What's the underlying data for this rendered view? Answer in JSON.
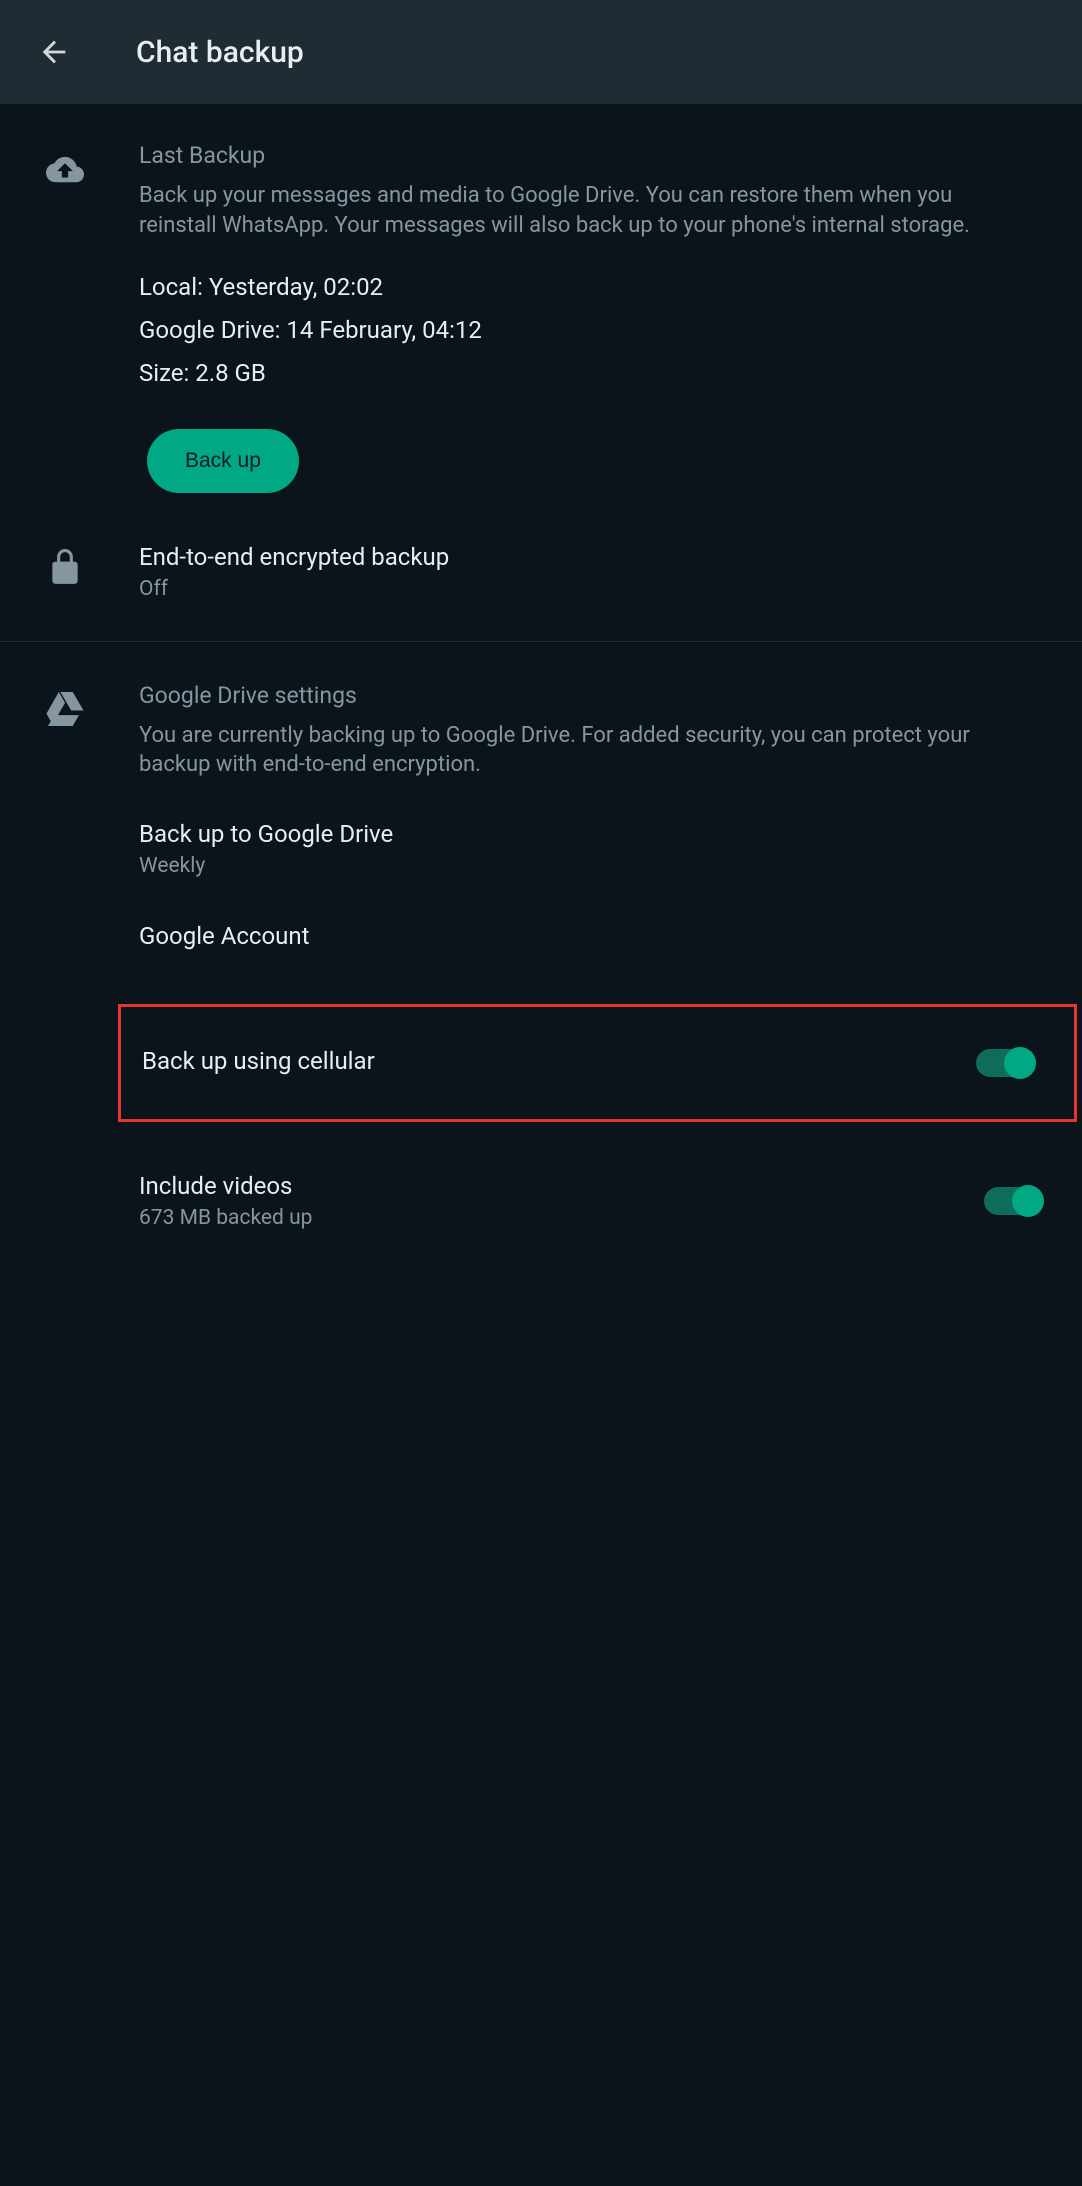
{
  "header": {
    "title": "Chat backup"
  },
  "lastBackup": {
    "title": "Last Backup",
    "description": "Back up your messages and media to Google Drive. You can restore them when you reinstall WhatsApp. Your messages will also back up to your phone's internal storage.",
    "local": "Local: Yesterday, 02:02",
    "googleDrive": "Google Drive: 14 February, 04:12",
    "size": "Size: 2.8 GB",
    "buttonLabel": "Back up"
  },
  "e2e": {
    "title": "End-to-end encrypted backup",
    "status": "Off"
  },
  "gdrive": {
    "title": "Google Drive settings",
    "description": "You are currently backing up to Google Drive. For added security, you can protect your backup with end-to-end encryption."
  },
  "settings": {
    "backupToGdrive": {
      "title": "Back up to Google Drive",
      "value": "Weekly"
    },
    "googleAccount": {
      "title": "Google Account"
    },
    "cellular": {
      "title": "Back up using cellular"
    },
    "videos": {
      "title": "Include videos",
      "subtitle": "673 MB backed up"
    }
  }
}
